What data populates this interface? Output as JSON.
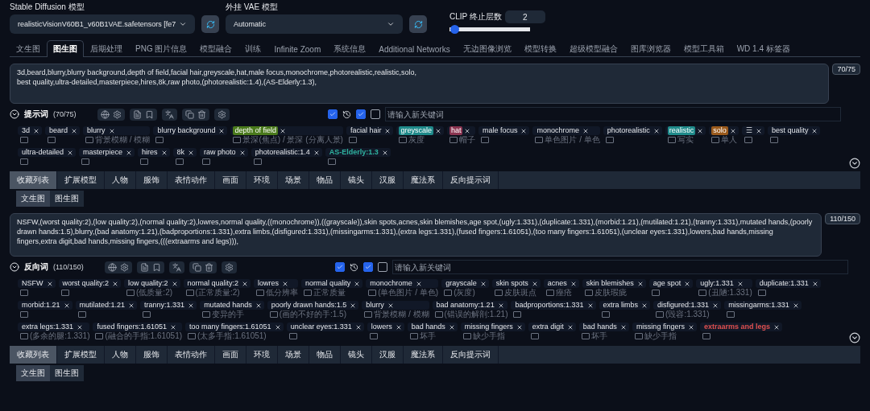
{
  "model_select": {
    "label": "Stable Diffusion 模型",
    "value": "realisticVisionV60B1_v60B1VAE.safetensors [fe7"
  },
  "vae_select": {
    "label": "外挂 VAE 模型",
    "value": "Automatic"
  },
  "clip_skip": {
    "label": "CLIP 终止层数",
    "value": "2",
    "level": 0.03
  },
  "tabs": [
    {
      "label": "文生图",
      "selected": false
    },
    {
      "label": "图生图",
      "selected": true
    },
    {
      "label": "后期处理",
      "selected": false
    },
    {
      "label": "PNG 图片信息",
      "selected": false
    },
    {
      "label": "模型融合",
      "selected": false
    },
    {
      "label": "训练",
      "selected": false
    },
    {
      "label": "Infinite Zoom",
      "selected": false
    },
    {
      "label": "系统信息",
      "selected": false
    },
    {
      "label": "Additional Networks",
      "selected": false
    },
    {
      "label": "无边图像浏览",
      "selected": false
    },
    {
      "label": "模型转换",
      "selected": false
    },
    {
      "label": "超级模型融合",
      "selected": false
    },
    {
      "label": "图库浏览器",
      "selected": false
    },
    {
      "label": "模型工具箱",
      "selected": false
    },
    {
      "label": "WD 1.4 标签器",
      "selected": false
    }
  ],
  "prompt": {
    "value": "3d,beard,blurry,blurry background,depth of field,facial hair,greyscale,hat,male focus,monochrome,photorealistic,realistic,solo,\nbest quality,ultra-detailed,masterpiece,hires,8k,raw photo,(photorealistic:1.4),(AS-Elderly:1.3),",
    "counter": "70/75",
    "title": "提示词",
    "count": "(70/75)",
    "checks": [
      true,
      true,
      false
    ],
    "search_placeholder": "请输入新关键词",
    "tags": [
      {
        "label": "3d"
      },
      {
        "label": "beard"
      },
      {
        "label": "blurry",
        "note": "背景模糊 / 模糊"
      },
      {
        "label": "blurry background"
      },
      {
        "label": "depth of field",
        "note": "景深(焦点) / 景深 (分离人景)",
        "color": "#4a7a1c",
        "kind": "fill"
      },
      {
        "label": "facial hair"
      },
      {
        "label": "greyscale",
        "note": "灰度",
        "color": "#1f8a8a",
        "kind": "fill"
      },
      {
        "label": "hat",
        "note": "帽子",
        "color": "#8a3450",
        "kind": "fill"
      },
      {
        "label": "male focus"
      },
      {
        "label": "monochrome",
        "note": "单色图片 / 单色"
      },
      {
        "label": "photorealistic"
      },
      {
        "label": "realistic",
        "note": "写实",
        "color": "#1f8a8a",
        "kind": "fill"
      },
      {
        "label": "solo",
        "note": "单人",
        "color": "#9a5a1c",
        "kind": "fill"
      },
      {
        "label": "☰"
      },
      {
        "label": "best quality"
      },
      {
        "label": "ultra-detailed"
      },
      {
        "label": "masterpiece"
      },
      {
        "label": "hires"
      },
      {
        "label": "8k"
      },
      {
        "label": "raw photo"
      },
      {
        "label": "photorealistic:1.4"
      },
      {
        "label": "AS-Elderly:1.3",
        "color": "#2fb3a0",
        "kind": "text"
      }
    ]
  },
  "categories": [
    {
      "label": "收藏列表",
      "selected": true
    },
    {
      "label": "扩展模型",
      "selected": false
    },
    {
      "label": "人物",
      "selected": false
    },
    {
      "label": "服饰",
      "selected": false
    },
    {
      "label": "表情动作",
      "selected": false
    },
    {
      "label": "画面",
      "selected": false
    },
    {
      "label": "环境",
      "selected": false
    },
    {
      "label": "场景",
      "selected": false
    },
    {
      "label": "物品",
      "selected": false
    },
    {
      "label": "镜头",
      "selected": false
    },
    {
      "label": "汉服",
      "selected": false
    },
    {
      "label": "魔法系",
      "selected": false
    },
    {
      "label": "反向提示词",
      "selected": false
    }
  ],
  "subtabs": [
    {
      "label": "文生图",
      "selected": true
    },
    {
      "label": "图生图",
      "selected": false
    }
  ],
  "negative": {
    "value": "NSFW,(worst quality:2),(low quality:2),(normal quality:2),lowres,normal quality,((monochrome)),((grayscale)),skin spots,acnes,skin blemishes,age spot,(ugly:1.331),(duplicate:1.331),(morbid:1.21),(mutilated:1.21),(tranny:1.331),mutated hands,(poorly drawn hands:1.5),blurry,(bad anatomy:1.21),(badproportions:1.331),extra limbs,(disfigured:1.331),(missingarms:1.331),(extra legs:1.331),(fused fingers:1.61051),(too many fingers:1.61051),(unclear eyes:1.331),lowers,bad hands,missing fingers,extra digit,bad hands,missing fingers,(((extraarms and legs))),",
    "counter": "110/150",
    "title": "反向词",
    "count": "(110/150)",
    "checks": [
      true,
      true,
      false
    ],
    "search_placeholder": "请输入新关键词",
    "tags": [
      {
        "label": "NSFW"
      },
      {
        "label": "worst quality:2"
      },
      {
        "label": "low quality:2",
        "note": "(低质量:2)"
      },
      {
        "label": "normal quality:2",
        "note": "(正常质量:2)"
      },
      {
        "label": "lowres",
        "note": "低分辨率"
      },
      {
        "label": "normal quality",
        "note": "正常质量"
      },
      {
        "label": "monochrome",
        "note": "(单色图片 / 单色)"
      },
      {
        "label": "grayscale",
        "note": "(灰度)"
      },
      {
        "label": "skin spots",
        "note": "皮肤斑点"
      },
      {
        "label": "acnes",
        "note": "痤疮"
      },
      {
        "label": "skin blemishes",
        "note": "皮肤瑕疵"
      },
      {
        "label": "age spot"
      },
      {
        "label": "ugly:1.331",
        "note": "(丑陋:1.331)"
      },
      {
        "label": "duplicate:1.331"
      },
      {
        "label": "morbid:1.21"
      },
      {
        "label": "mutilated:1.21"
      },
      {
        "label": "tranny:1.331"
      },
      {
        "label": "mutated hands",
        "note": "变异的手"
      },
      {
        "label": "poorly drawn hands:1.5",
        "note": "(画的不好的手:1.5)"
      },
      {
        "label": "blurry",
        "note": "背景模糊 / 模糊"
      },
      {
        "label": "bad anatomy:1.21",
        "note": "(错误的解剖:1.21)"
      },
      {
        "label": "badproportions:1.331"
      },
      {
        "label": "extra limbs"
      },
      {
        "label": "disfigured:1.331",
        "note": "(毁容:1.331)"
      },
      {
        "label": "missingarms:1.331"
      },
      {
        "label": "extra legs:1.331",
        "note": "(多余的腿:1.331)"
      },
      {
        "label": "fused fingers:1.61051",
        "note": "(融合的手指:1.61051)"
      },
      {
        "label": "too many fingers:1.61051",
        "note": "(太多手指:1.61051)"
      },
      {
        "label": "unclear eyes:1.331"
      },
      {
        "label": "lowers"
      },
      {
        "label": "bad hands",
        "note": "坏手"
      },
      {
        "label": "missing fingers",
        "note": "缺少手指"
      },
      {
        "label": "extra digit"
      },
      {
        "label": "bad hands",
        "note": "坏手"
      },
      {
        "label": "missing fingers",
        "note": "缺少手指"
      },
      {
        "label": "extraarms and legs",
        "color": "#e05050",
        "kind": "text"
      }
    ]
  },
  "neg_categories": [
    {
      "label": "收藏列表",
      "selected": true
    },
    {
      "label": "扩展模型",
      "selected": false
    },
    {
      "label": "人物",
      "selected": false
    },
    {
      "label": "服饰",
      "selected": false
    },
    {
      "label": "表情动作",
      "selected": false
    },
    {
      "label": "画面",
      "selected": false
    },
    {
      "label": "环境",
      "selected": false
    },
    {
      "label": "场景",
      "selected": false
    },
    {
      "label": "物品",
      "selected": false
    },
    {
      "label": "镜头",
      "selected": false
    },
    {
      "label": "汉服",
      "selected": false
    },
    {
      "label": "魔法系",
      "selected": false
    },
    {
      "label": "反向提示词",
      "selected": false
    }
  ],
  "neg_subtabs": [
    {
      "label": "文生图",
      "selected": true
    },
    {
      "label": "图生图",
      "selected": false
    }
  ]
}
